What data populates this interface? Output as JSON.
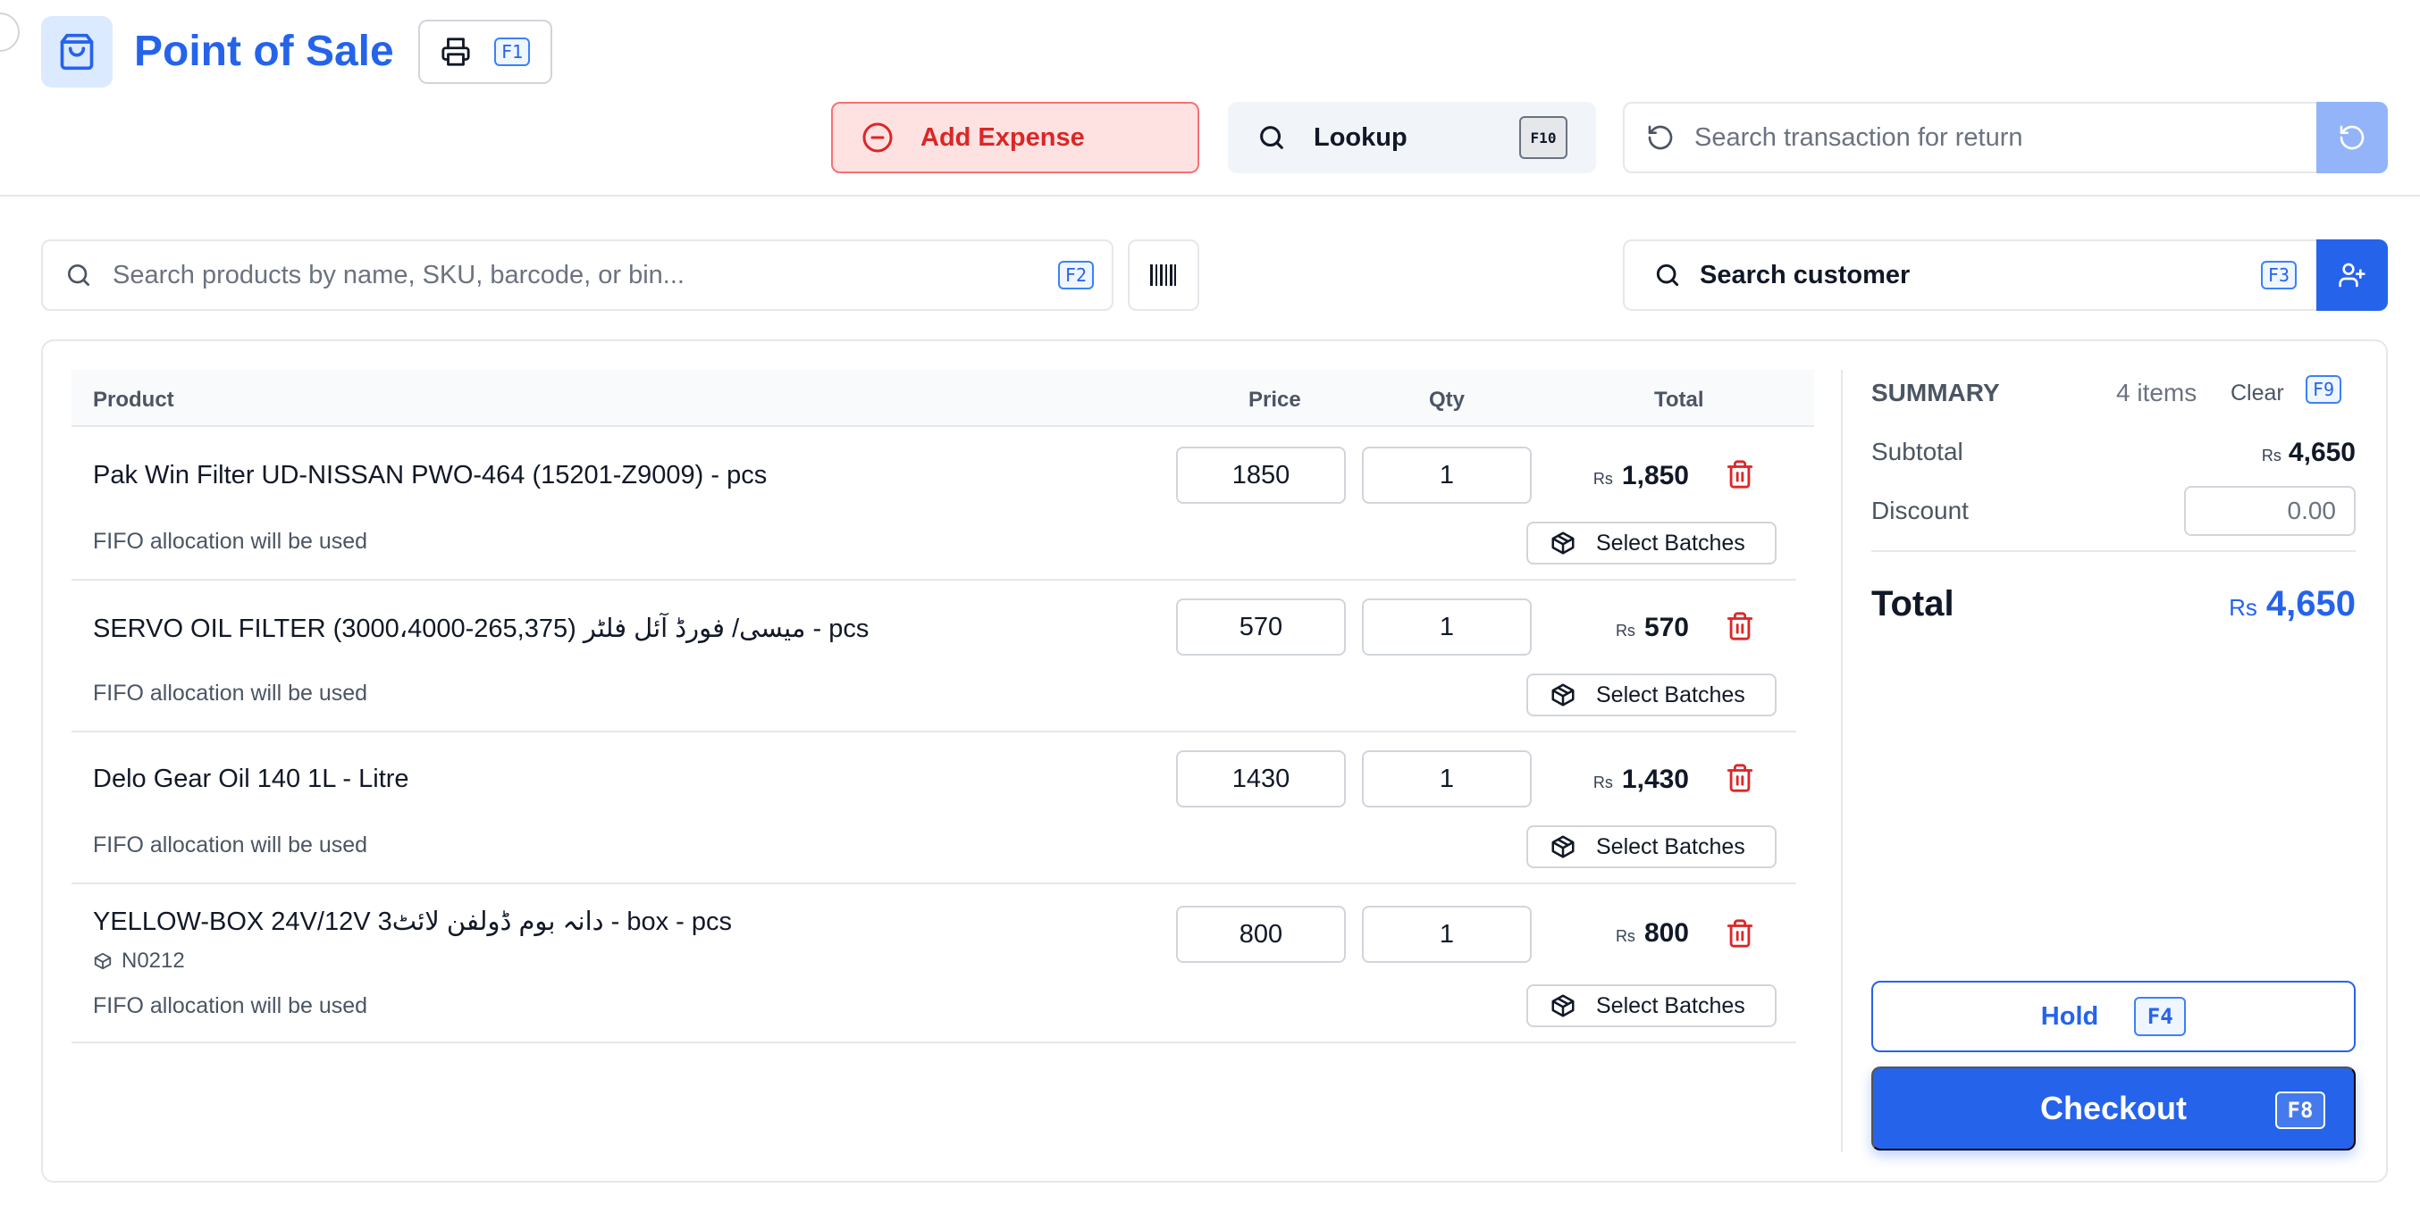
{
  "header": {
    "title": "Point of Sale",
    "print_shortcut": "F1",
    "add_expense_label": "Add Expense",
    "lookup_label": "Lookup",
    "lookup_shortcut": "F10",
    "return_search_placeholder": "Search transaction for return"
  },
  "search": {
    "product_placeholder": "Search products by name, SKU, barcode, or bin...",
    "product_shortcut": "F2",
    "customer_label": "Search customer",
    "customer_shortcut": "F3"
  },
  "cart": {
    "columns": {
      "product": "Product",
      "price": "Price",
      "qty": "Qty",
      "total": "Total"
    },
    "currency": "Rs",
    "batch_label": "Select Batches",
    "items": [
      {
        "name": "Pak Win Filter UD-NISSAN PWO-464 (15201-Z9009) - pcs",
        "sku": "",
        "price": "1850",
        "qty": "1",
        "total": "1,850",
        "allocation": "FIFO allocation will be used"
      },
      {
        "name": "SERVO OIL FILTER (3000،4000-265,375) میسی/ فورڈ آئل فلٹر - pcs",
        "sku": "",
        "price": "570",
        "qty": "1",
        "total": "570",
        "allocation": "FIFO allocation will be used"
      },
      {
        "name": "Delo Gear Oil 140 1L - Litre",
        "sku": "",
        "price": "1430",
        "qty": "1",
        "total": "1,430",
        "allocation": "FIFO allocation will be used"
      },
      {
        "name": "YELLOW-BOX 24V/12V 3دانہ بوم ڈولفن لائٹ - box - pcs",
        "sku": "N0212",
        "price": "800",
        "qty": "1",
        "total": "800",
        "allocation": "FIFO allocation will be used"
      }
    ]
  },
  "summary": {
    "title": "SUMMARY",
    "count": "4 items",
    "clear_label": "Clear",
    "clear_shortcut": "F9",
    "subtotal_label": "Subtotal",
    "subtotal_value": "4,650",
    "discount_label": "Discount",
    "discount_value": "0.00",
    "total_label": "Total",
    "total_value": "4,650",
    "hold_label": "Hold",
    "hold_shortcut": "F4",
    "checkout_label": "Checkout",
    "checkout_shortcut": "F8"
  },
  "colors": {
    "accent": "#2563eb",
    "danger": "#dc2626",
    "danger_bg": "#fee2e2",
    "border": "#e5e7eb"
  }
}
